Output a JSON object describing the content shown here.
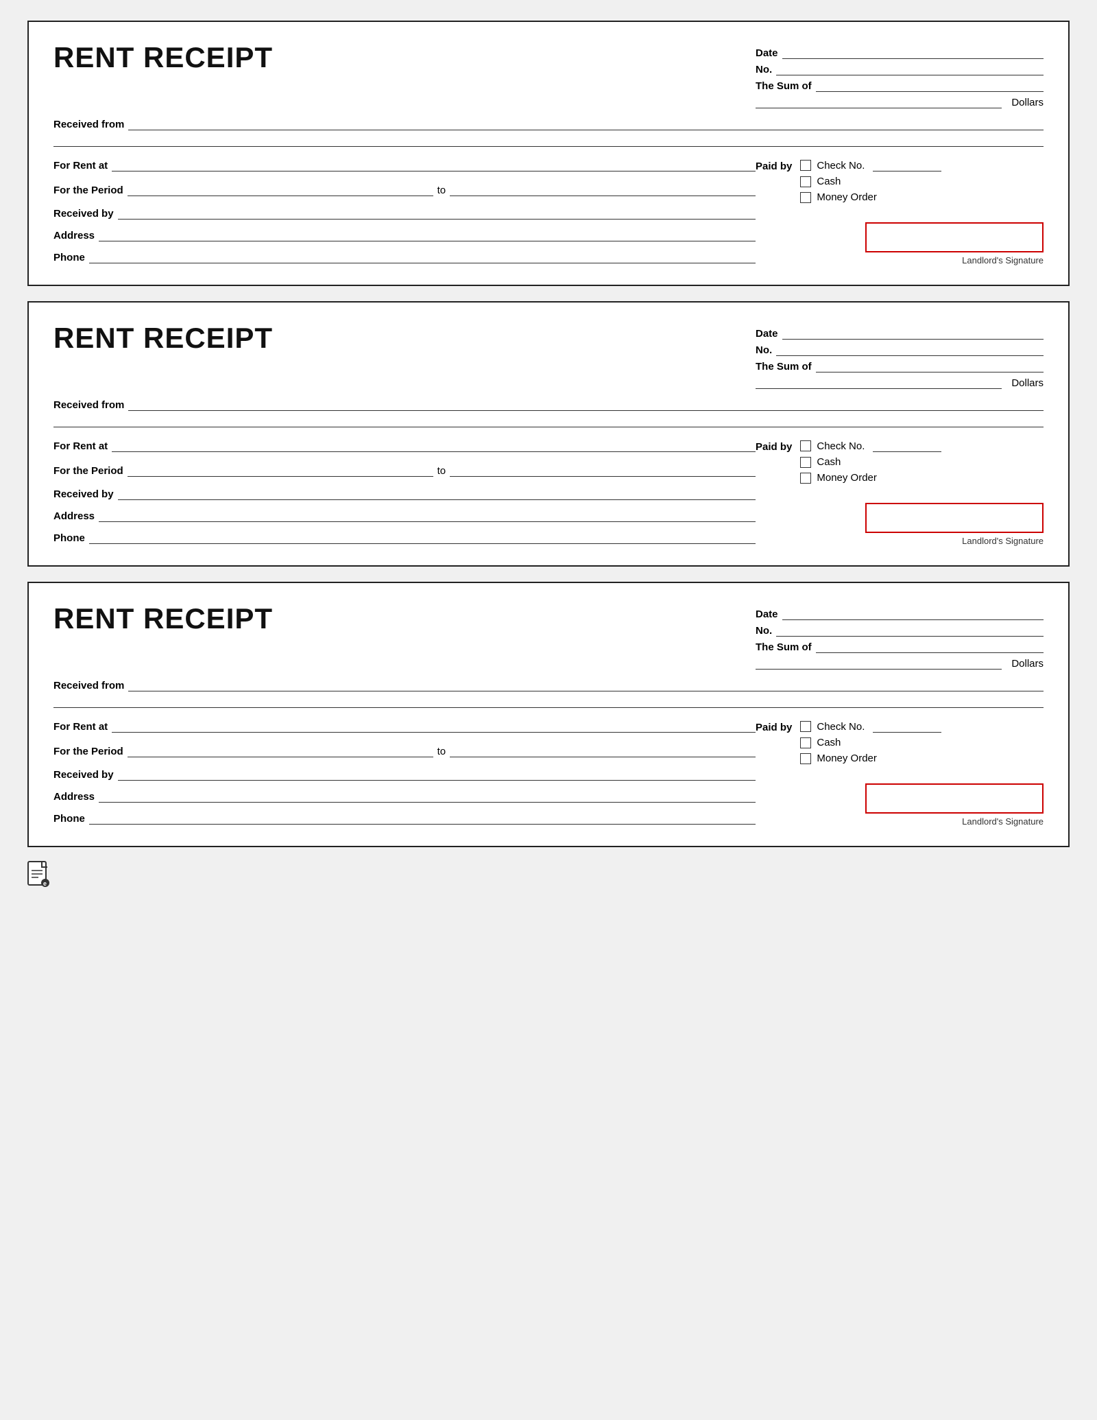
{
  "receipts": [
    {
      "id": "receipt-1",
      "title": "RENT RECEIPT",
      "date_label": "Date",
      "no_label": "No.",
      "sum_label": "The Sum of",
      "dollars_label": "Dollars",
      "received_from_label": "Received from",
      "for_rent_at_label": "For Rent at",
      "paid_by_label": "Paid by",
      "for_period_label": "For the Period",
      "to_label": "to",
      "received_by_label": "Received by",
      "address_label": "Address",
      "phone_label": "Phone",
      "check_no_label": "Check No.",
      "cash_label": "Cash",
      "money_order_label": "Money Order",
      "signature_label": "Landlord's Signature"
    },
    {
      "id": "receipt-2",
      "title": "RENT RECEIPT",
      "date_label": "Date",
      "no_label": "No.",
      "sum_label": "The Sum of",
      "dollars_label": "Dollars",
      "received_from_label": "Received from",
      "for_rent_at_label": "For Rent at",
      "paid_by_label": "Paid by",
      "for_period_label": "For the Period",
      "to_label": "to",
      "received_by_label": "Received by",
      "address_label": "Address",
      "phone_label": "Phone",
      "check_no_label": "Check No.",
      "cash_label": "Cash",
      "money_order_label": "Money Order",
      "signature_label": "Landlord's Signature"
    },
    {
      "id": "receipt-3",
      "title": "RENT RECEIPT",
      "date_label": "Date",
      "no_label": "No.",
      "sum_label": "The Sum of",
      "dollars_label": "Dollars",
      "received_from_label": "Received from",
      "for_rent_at_label": "For Rent at",
      "paid_by_label": "Paid by",
      "for_period_label": "For the Period",
      "to_label": "to",
      "received_by_label": "Received by",
      "address_label": "Address",
      "phone_label": "Phone",
      "check_no_label": "Check No.",
      "cash_label": "Cash",
      "money_order_label": "Money Order",
      "signature_label": "Landlord's Signature"
    }
  ],
  "footer_icon": "document"
}
